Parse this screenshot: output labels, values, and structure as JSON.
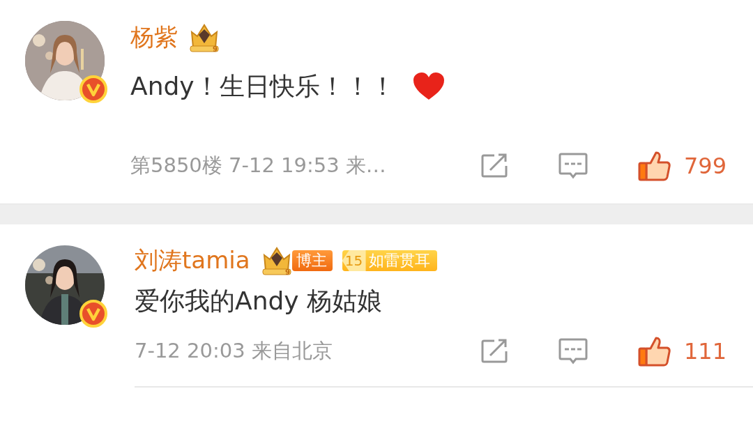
{
  "comments": [
    {
      "name": "杨紫",
      "crown_level": "9",
      "text": "Andy！生日快乐！！！",
      "heart": true,
      "meta": "第5850楼 7-12 19:53 来…",
      "liked": true,
      "likes": "799",
      "verified": true
    },
    {
      "name": "刘涛tamia",
      "crown_level": "9",
      "tags": [
        {
          "kind": "role",
          "label": "博主"
        },
        {
          "kind": "fan",
          "level": "15",
          "label": "如雷贯耳"
        }
      ],
      "text": "爱你我的Andy 杨姑娘",
      "heart": false,
      "meta": "7-12 20:03 来自北京",
      "liked": true,
      "likes": "111",
      "verified": true
    }
  ]
}
